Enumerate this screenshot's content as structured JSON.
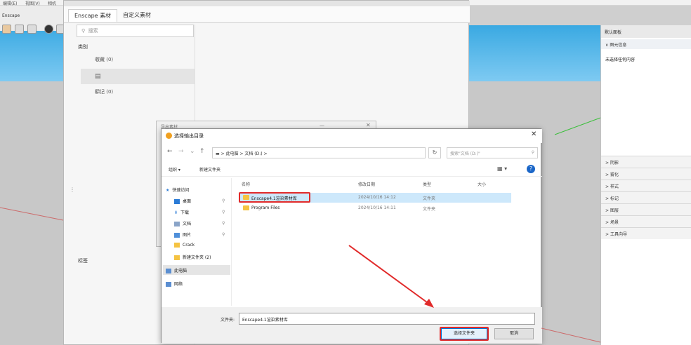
{
  "background": {
    "menu": [
      "编辑(E)",
      "视图(V)",
      "相机"
    ],
    "app_name": "Enscape"
  },
  "right_panel": {
    "title": "默认面板",
    "section": "图元信息",
    "content": "未选择任何内容",
    "items": [
      "阴影",
      "雾化",
      "样式",
      "标记",
      "图层",
      "场景",
      "工具向导"
    ]
  },
  "material_window": {
    "tabs": [
      "Enscape 素材",
      "自定义素材"
    ],
    "search_placeholder": "搜索",
    "category_title": "类别",
    "categories": [
      "收藏 (0)",
      "",
      "标记 (0)"
    ],
    "tags_label": "标签"
  },
  "shadow_dialog": {
    "title": "导出素材"
  },
  "folder_dialog": {
    "title": "选择输出目录",
    "address": [
      "此电脑",
      "文档 (D:)"
    ],
    "search_placeholder": "搜索\"文档 (D:)\"",
    "organize": "组织 ▾",
    "new_folder": "新建文件夹",
    "nav_items": [
      {
        "label": "快速访问"
      },
      {
        "label": "桌面",
        "pinned": true
      },
      {
        "label": "下载",
        "pinned": true
      },
      {
        "label": "文档",
        "pinned": true
      },
      {
        "label": "图片",
        "pinned": true
      },
      {
        "label": "Crack"
      },
      {
        "label": "新建文件夹 (2)"
      },
      {
        "label": "此电脑"
      },
      {
        "label": "网络"
      }
    ],
    "columns": [
      "名称",
      "修改日期",
      "类型",
      "大小"
    ],
    "files": [
      {
        "name": "Enscape4.1渲染素材库",
        "date": "2024/10/16 14:12",
        "type": "文件夹"
      },
      {
        "name": "Program Files",
        "date": "2024/10/16 14:11",
        "type": "文件夹"
      }
    ],
    "filename_label": "文件夹:",
    "filename_value": "Enscape4.1渲染素材库",
    "select_button": "选择文件夹",
    "cancel_button": "取消"
  },
  "colors": {
    "highlight": "#e12a2a",
    "accent": "#0078d7",
    "sky": "#3aa9e2"
  }
}
